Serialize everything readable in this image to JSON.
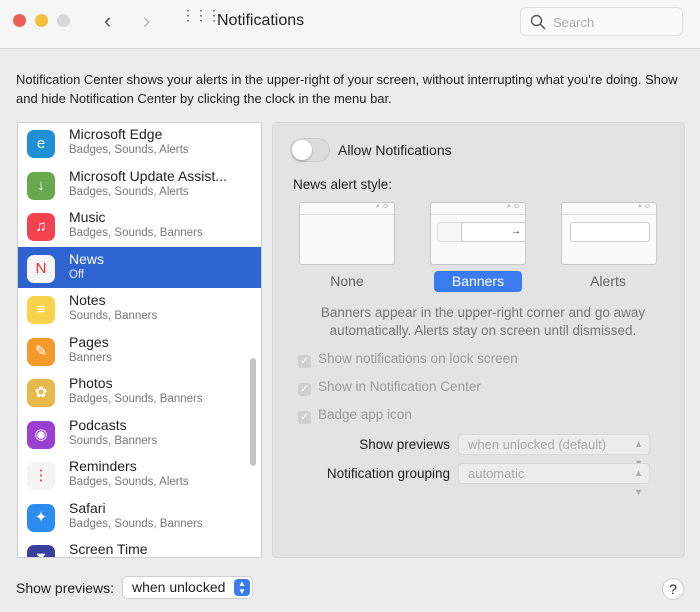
{
  "window": {
    "title": "Notifications",
    "search_placeholder": "Search"
  },
  "description": "Notification Center shows your alerts in the upper-right of your screen, without interrupting what you're doing. Show and hide Notification Center by clicking the clock in the menu bar.",
  "apps": [
    {
      "name": "Microsoft Edge",
      "sub": "Badges, Sounds, Alerts",
      "color": "#1f8fd6",
      "glyph": "e"
    },
    {
      "name": "Microsoft Update Assist...",
      "sub": "Badges, Sounds, Alerts",
      "color": "#6aa84f",
      "glyph": "↓"
    },
    {
      "name": "Music",
      "sub": "Badges, Sounds, Banners",
      "color": "#f2424f",
      "glyph": "♫"
    },
    {
      "name": "News",
      "sub": "Off",
      "color": "#f5f5f5",
      "glyph": "N"
    },
    {
      "name": "Notes",
      "sub": "Sounds, Banners",
      "color": "#f7d24a",
      "glyph": "≡"
    },
    {
      "name": "Pages",
      "sub": "Banners",
      "color": "#f39a2b",
      "glyph": "✎"
    },
    {
      "name": "Photos",
      "sub": "Badges, Sounds, Banners",
      "color": "#e8b84a",
      "glyph": "✿"
    },
    {
      "name": "Podcasts",
      "sub": "Sounds, Banners",
      "color": "#9a3fd0",
      "glyph": "◉"
    },
    {
      "name": "Reminders",
      "sub": "Badges, Sounds, Alerts",
      "color": "#f4f4f4",
      "glyph": "⋮"
    },
    {
      "name": "Safari",
      "sub": "Badges, Sounds, Banners",
      "color": "#2d8cf0",
      "glyph": "✦"
    },
    {
      "name": "Screen Time",
      "sub": "",
      "color": "#3b3f9c",
      "glyph": "⧗"
    }
  ],
  "selected_app": "News",
  "panel": {
    "allow_label": "Allow Notifications",
    "allow_on": false,
    "style_label": "News alert style:",
    "styles": [
      "None",
      "Banners",
      "Alerts"
    ],
    "selected_style": "Banners",
    "help": "Banners appear in the upper-right corner and go away automatically. Alerts stay on screen until dismissed.",
    "checks": [
      "Show notifications on lock screen",
      "Show in Notification Center",
      "Badge app icon"
    ],
    "show_previews_label": "Show previews",
    "show_previews_value": "when unlocked (default)",
    "grouping_label": "Notification grouping",
    "grouping_value": "automatic"
  },
  "footer": {
    "show_previews_label": "Show previews:",
    "show_previews_value": "when unlocked",
    "help": "?"
  }
}
